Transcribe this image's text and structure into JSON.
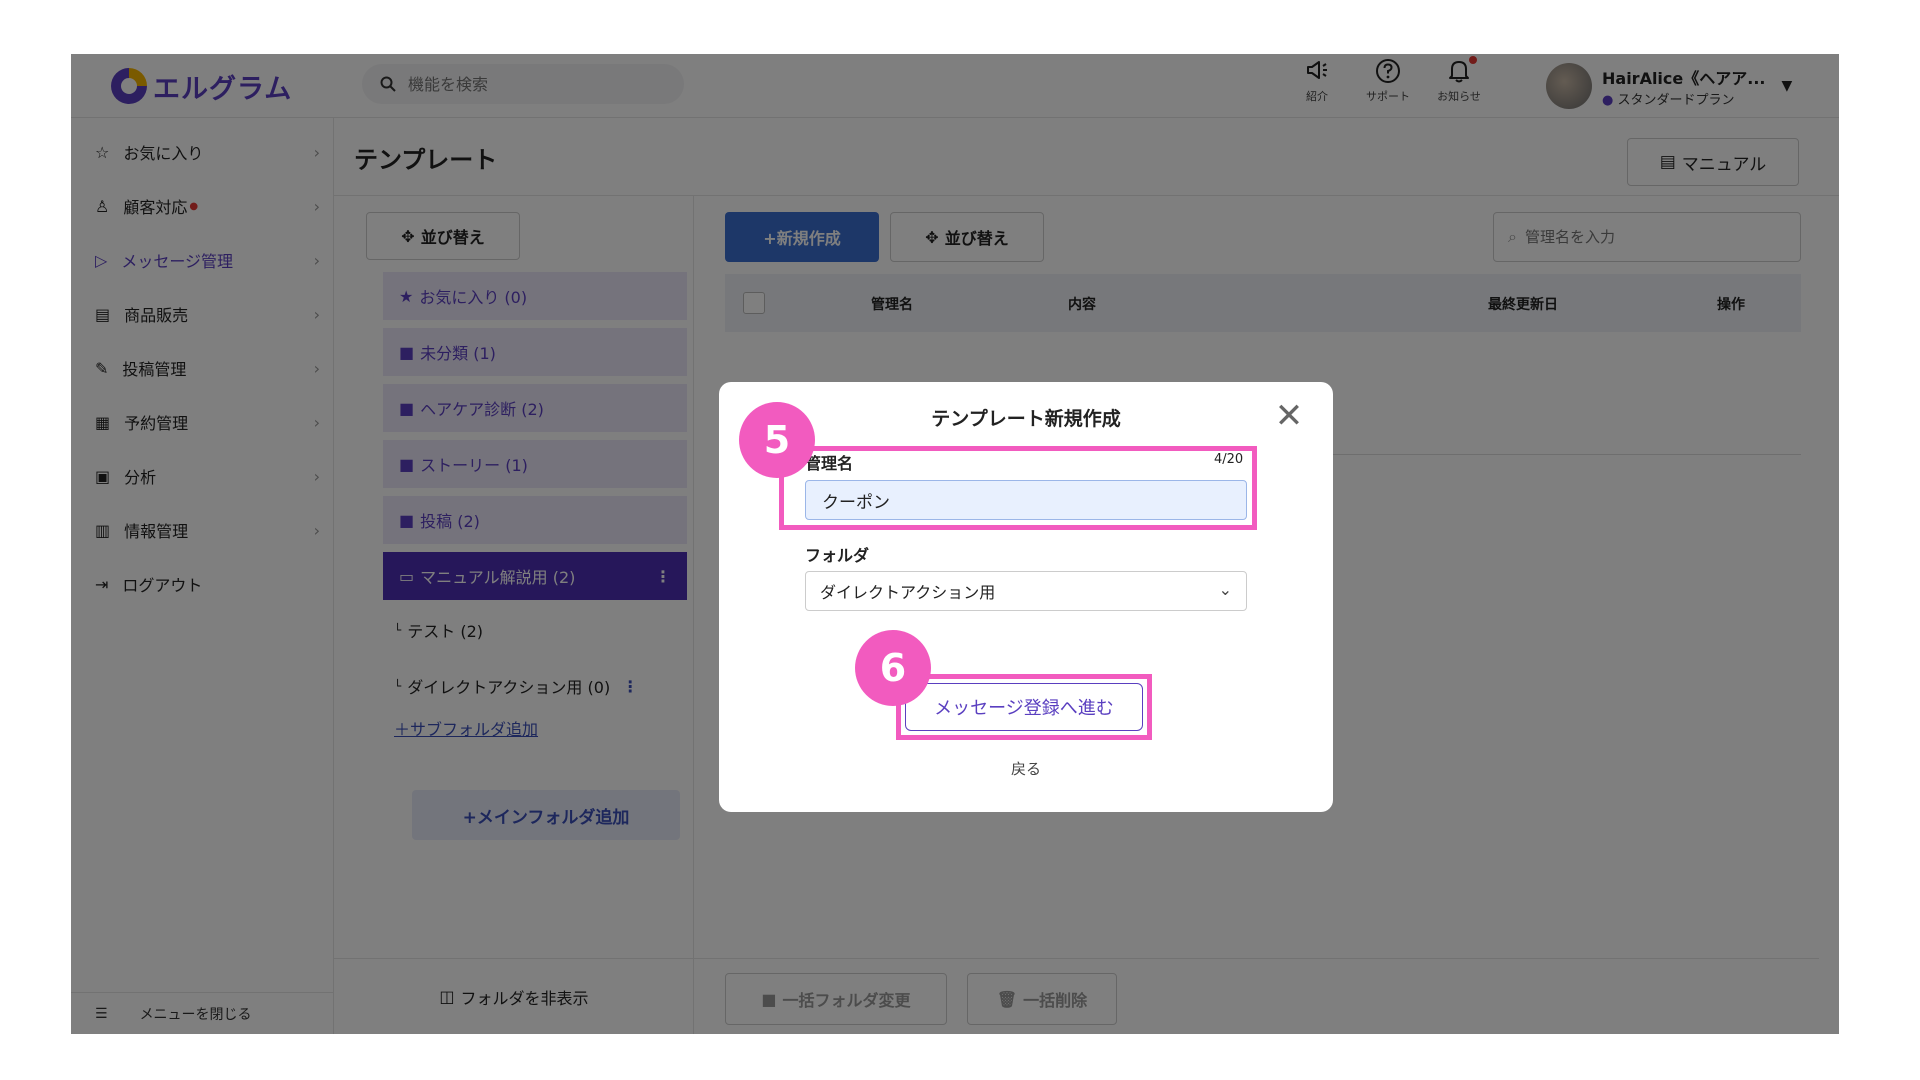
{
  "app": {
    "logo_text": "エルグラム"
  },
  "header": {
    "search_placeholder": "機能を検索",
    "icons": [
      {
        "name": "megaphone-icon",
        "label": "紹介"
      },
      {
        "name": "help-icon",
        "label": "サポート"
      },
      {
        "name": "bell-icon",
        "label": "お知らせ"
      }
    ],
    "user_name": "HairAlice《ヘアア...",
    "user_plan": "スタンダードプラン"
  },
  "sidebar": {
    "items": [
      {
        "label": "お気に入り",
        "icon": "star-icon"
      },
      {
        "label": "顧客対応",
        "icon": "person-icon"
      },
      {
        "label": "メッセージ管理",
        "icon": "send-icon"
      },
      {
        "label": "商品販売",
        "icon": "store-icon"
      },
      {
        "label": "投稿管理",
        "icon": "edit-icon"
      },
      {
        "label": "予約管理",
        "icon": "calendar-icon"
      },
      {
        "label": "分析",
        "icon": "report-icon"
      },
      {
        "label": "情報管理",
        "icon": "chart-icon"
      },
      {
        "label": "ログアウト",
        "icon": "logout-icon"
      }
    ],
    "close_menu": "メニューを閉じる"
  },
  "page": {
    "title": "テンプレート",
    "manual_label": "マニュアル"
  },
  "folders": {
    "sort_label": "並び替え",
    "items": [
      {
        "label": "お気に入り (0)"
      },
      {
        "label": "未分類 (1)"
      },
      {
        "label": "ヘアケア診断 (2)"
      },
      {
        "label": "ストーリー (1)"
      },
      {
        "label": "投稿 (2)"
      },
      {
        "label": "マニュアル解説用 (2)"
      }
    ],
    "subs": [
      {
        "label": "テスト (2)"
      },
      {
        "label": "ダイレクトアクション用 (0)"
      }
    ],
    "add_sub": "サブフォルダ追加",
    "add_main": "+メインフォルダ追加",
    "hide_folders": "フォルダを非表示"
  },
  "list": {
    "new_label": "+新規作成",
    "sort_label": "並び替え",
    "search_placeholder": "管理名を入力",
    "columns": [
      "管理名",
      "内容",
      "最終更新日",
      "操作"
    ],
    "bulk_folder": "一括フォルダ変更",
    "bulk_delete": "一括削除"
  },
  "modal": {
    "title": "テンプレート新規作成",
    "name_label": "管理名",
    "counter": "4/20",
    "name_value": "クーポン",
    "folder_label": "フォルダ",
    "folder_value": "ダイレクトアクション用",
    "proceed_label": "メッセージ登録へ進む",
    "back_label": "戻る"
  },
  "annotations": {
    "step_a": "5",
    "step_b": "6",
    "highlight_color": "#f25bbf"
  },
  "colors": {
    "brand": "#5a3fc0",
    "primary_button": "#3b6fd1"
  }
}
